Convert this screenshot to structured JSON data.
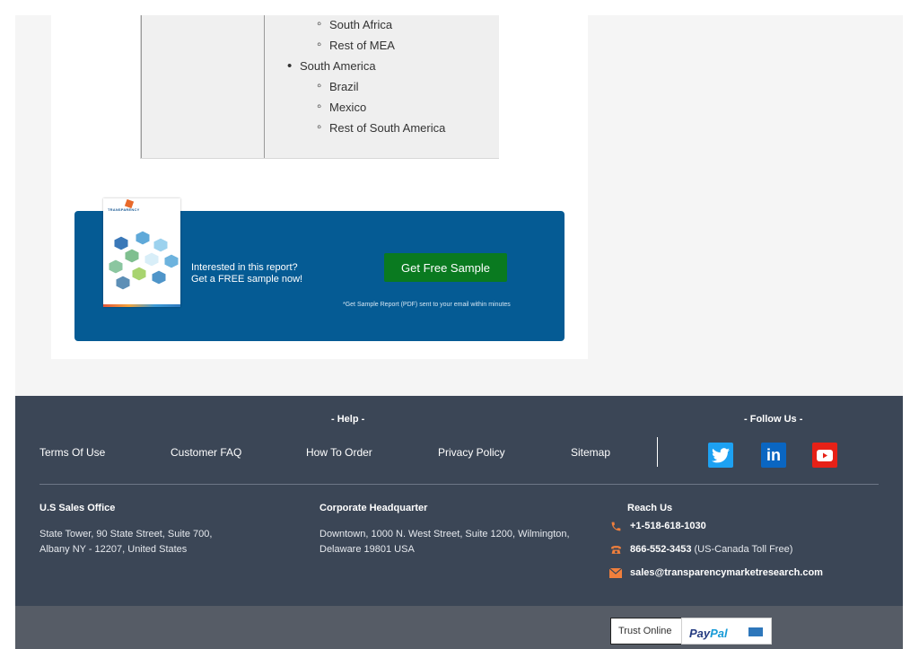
{
  "region_table": {
    "items": [
      {
        "label": "South Africa",
        "level": 2
      },
      {
        "label": "Rest of MEA",
        "level": 2
      },
      {
        "label": "South America",
        "level": 1
      },
      {
        "label": "Brazil",
        "level": 2
      },
      {
        "label": "Mexico",
        "level": 2
      },
      {
        "label": "Rest of South America",
        "level": 2
      }
    ]
  },
  "sample_banner": {
    "cover_brand": "TRANSPARENCY",
    "line1": "Interested in this report?",
    "line2": "Get a FREE sample now!",
    "button_label": "Get Free Sample",
    "note": "*Get Sample Report (PDF) sent to your email within minutes",
    "background_color": "#055b94",
    "button_color": "#0a7a20"
  },
  "footer": {
    "help_title": "- Help -",
    "follow_title": "- Follow Us -",
    "nav_links": [
      "Terms Of Use",
      "Customer FAQ",
      "How To Order",
      "Privacy Policy",
      "Sitemap"
    ],
    "social": [
      {
        "icon": "twitter-icon",
        "color": "#1da1f2"
      },
      {
        "icon": "linkedin-icon",
        "color": "#0a66c2"
      },
      {
        "icon": "youtube-icon",
        "color": "#e62117"
      }
    ],
    "us_office": {
      "title": "U.S Sales Office",
      "line1": "State Tower, 90 State Street, Suite 700,",
      "line2": "Albany NY - 12207, United States"
    },
    "hq": {
      "title": "Corporate Headquarter",
      "line1": "Downtown, 1000 N. West Street, Suite 1200, Wilmington,",
      "line2": "Delaware 19801 USA"
    },
    "reach": {
      "title": "Reach Us",
      "phone": "+1-518-618-1030",
      "tollfree": "866-552-3453",
      "tollfree_note": "(US-Canada Toll Free)",
      "email": "sales@transparencymarketresearch.com",
      "icon_color": "#f07f3c"
    },
    "background_color": "#3b4656"
  },
  "subfooter": {
    "trust_label": "Trust Online",
    "paypal_pay": "Pay",
    "paypal_pal": "Pal"
  }
}
